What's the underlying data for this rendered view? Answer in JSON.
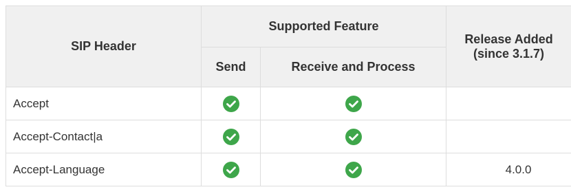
{
  "table": {
    "headers": {
      "sip_header": "SIP Header",
      "supported_feature": "Supported Feature",
      "send": "Send",
      "receive_and_process": "Receive and Process",
      "release_added_line1": "Release Added",
      "release_added_line2": "(since 3.1.7)"
    },
    "rows": [
      {
        "header": "Accept",
        "send": "check-icon",
        "receive": "check-icon",
        "release": ""
      },
      {
        "header": "Accept-Contact|a",
        "send": "check-icon",
        "receive": "check-icon",
        "release": ""
      },
      {
        "header": "Accept-Language",
        "send": "check-icon",
        "receive": "check-icon",
        "release": "4.0.0"
      }
    ]
  },
  "colors": {
    "header_bg": "#f0f0f0",
    "border": "#dddddd",
    "check_green": "#3ea64a"
  }
}
